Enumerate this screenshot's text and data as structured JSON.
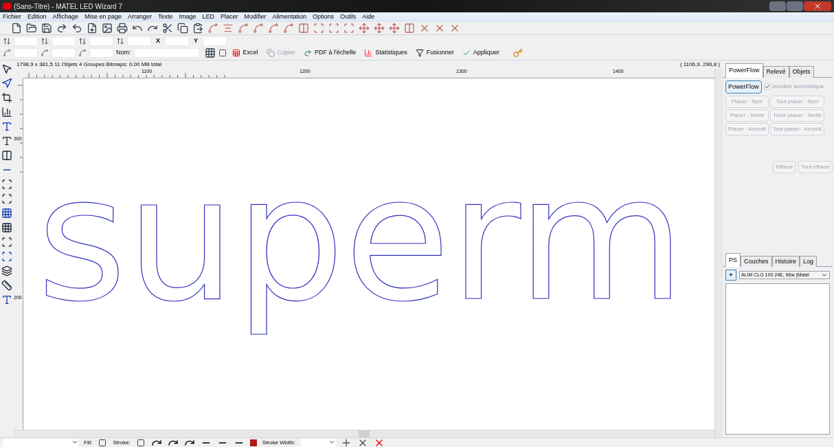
{
  "window": {
    "title": "(Sans-Titre) - MATEL LED Wizard 7"
  },
  "menu": [
    "Fichier",
    "Edition",
    "Affichage",
    "Mise en page",
    "Arranger",
    "Texte",
    "Image",
    "LED",
    "Placer",
    "Modifier",
    "Alimentation",
    "Options",
    "Outils",
    "Aide"
  ],
  "fields_row_1": [
    {
      "kind": "icon"
    },
    {
      "kind": "icon"
    },
    {
      "kind": "icon"
    },
    {
      "kind": "icon"
    },
    {
      "kind": "label",
      "label": "X"
    },
    {
      "kind": "label",
      "label": "Y"
    }
  ],
  "fields_row_2": [
    {
      "kind": "icon"
    },
    {
      "kind": "icon"
    },
    {
      "kind": "icon"
    },
    {
      "kind": "label",
      "label": "Nom:"
    }
  ],
  "actions": [
    {
      "label": "Excel",
      "disabled": false
    },
    {
      "label": "Copier",
      "disabled": true
    },
    {
      "label": "PDF à l'échelle",
      "disabled": false
    },
    {
      "label": "Statistiques",
      "disabled": false
    },
    {
      "label": "Fusionner",
      "disabled": false
    },
    {
      "label": "Appliquer",
      "disabled": false
    }
  ],
  "canvas": {
    "info": "1798,9 x 381,5 11 Objets 4 Groupes Bitmaps: 0.00 MB total",
    "coordinates": "( 1106,9,  296,8 )",
    "top_ruler": [
      "1100",
      "1200",
      "1300",
      "1400"
    ],
    "left_ruler": [
      "300",
      "200"
    ],
    "artwork_text": "superm"
  },
  "panel_top": {
    "tabs": [
      {
        "label": "PowerFlow",
        "selected": true
      },
      {
        "label": "Relevé",
        "selected": false
      },
      {
        "label": "Objets",
        "selected": false
      }
    ],
    "powerflow_button": {
      "label": "PowerFlow",
      "disabled": false
    },
    "auto_junction": {
      "label": "Jonction automatique",
      "checked": true,
      "disabled": true
    },
    "place_buttons": [
      {
        "label": "Placer : Sym",
        "disabled": true
      },
      {
        "label": "Tout placer : Sym",
        "disabled": true
      },
      {
        "label": "Placer : Sérifs",
        "disabled": true
      },
      {
        "label": "Toute placer : Sérifs",
        "disabled": true
      },
      {
        "label": "Placer : Arrondi",
        "disabled": true
      },
      {
        "label": "Tout placer : Arrondi",
        "disabled": true
      }
    ],
    "clear_buttons": [
      {
        "label": "Effacer",
        "disabled": true
      },
      {
        "label": "Tout effacer",
        "disabled": true
      }
    ]
  },
  "panel_bottom": {
    "tabs": [
      {
        "label": "PS",
        "selected": true
      },
      {
        "label": "Couches",
        "selected": false
      },
      {
        "label": "Histoire",
        "selected": false
      },
      {
        "label": "Log",
        "selected": false
      }
    ],
    "add_button": "+",
    "power_supply": "ALIM CLG 100 24E, 96w (Matel"
  },
  "status_bar": {
    "fill_label": "Fill:",
    "stroke_label": "Stroke:",
    "stroke_width_label": "Stroke Width:"
  }
}
